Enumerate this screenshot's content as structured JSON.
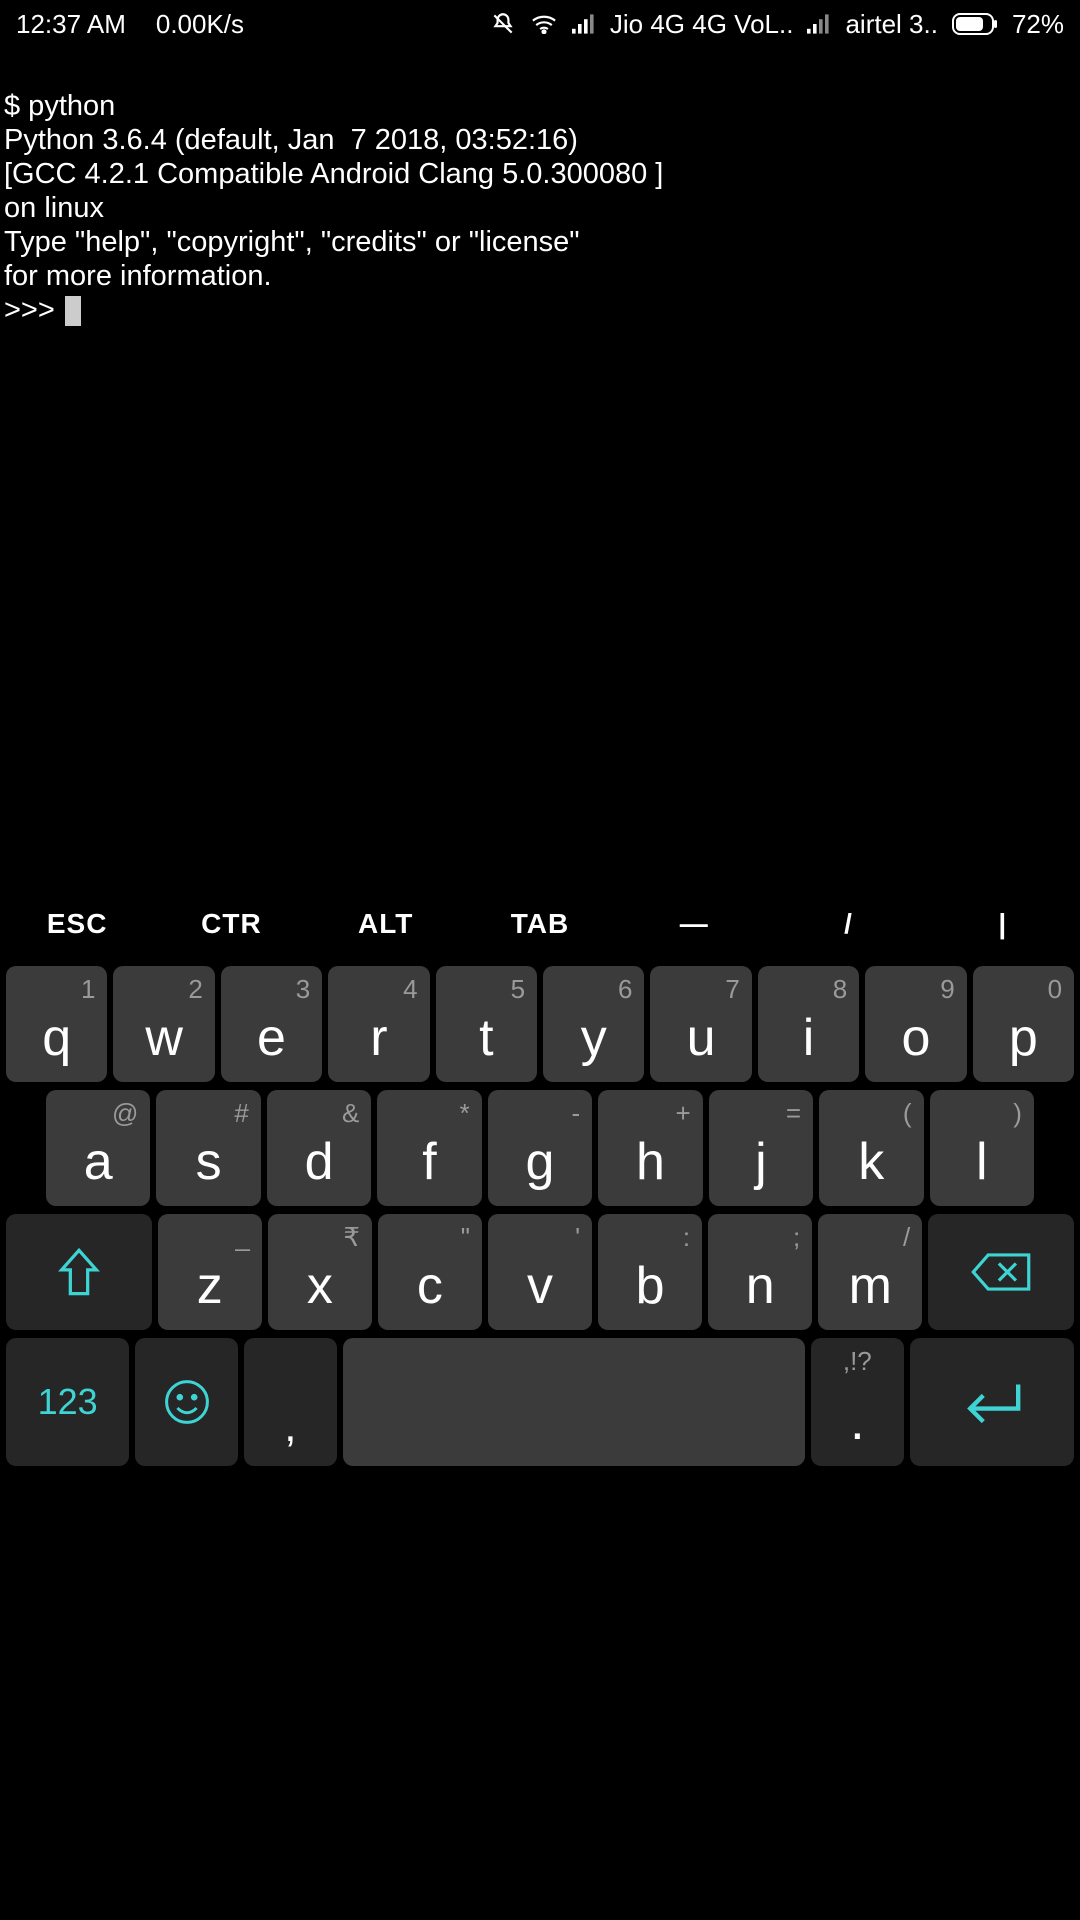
{
  "statusbar": {
    "time": "12:37 AM",
    "speed": "0.00K/s",
    "net1": "Jio 4G 4G VoL..",
    "net2": "airtel 3..",
    "battery": "72%"
  },
  "terminal": {
    "line1": "$ python",
    "line2": "Python 3.6.4 (default, Jan  7 2018, 03:52:16)",
    "line3": "[GCC 4.2.1 Compatible Android Clang 5.0.300080 ]",
    "line4": "on linux",
    "line5": "Type \"help\", \"copyright\", \"credits\" or \"license\"",
    "line6": "for more information.",
    "prompt": ">>> "
  },
  "extrakeys": {
    "esc": "ESC",
    "ctr": "CTR",
    "alt": "ALT",
    "tab": "TAB",
    "dash": "—",
    "slash": "/",
    "pipe": "|"
  },
  "keys": {
    "row1": [
      {
        "h": "1",
        "m": "q"
      },
      {
        "h": "2",
        "m": "w"
      },
      {
        "h": "3",
        "m": "e"
      },
      {
        "h": "4",
        "m": "r"
      },
      {
        "h": "5",
        "m": "t"
      },
      {
        "h": "6",
        "m": "y"
      },
      {
        "h": "7",
        "m": "u"
      },
      {
        "h": "8",
        "m": "i"
      },
      {
        "h": "9",
        "m": "o"
      },
      {
        "h": "0",
        "m": "p"
      }
    ],
    "row2": [
      {
        "h": "@",
        "m": "a"
      },
      {
        "h": "#",
        "m": "s"
      },
      {
        "h": "&",
        "m": "d"
      },
      {
        "h": "*",
        "m": "f"
      },
      {
        "h": "-",
        "m": "g"
      },
      {
        "h": "+",
        "m": "h"
      },
      {
        "h": "=",
        "m": "j"
      },
      {
        "h": "(",
        "m": "k"
      },
      {
        "h": ")",
        "m": "l"
      }
    ],
    "row3": [
      {
        "h": "_",
        "m": "z"
      },
      {
        "h": "₹",
        "m": "x"
      },
      {
        "h": "\"",
        "m": "c"
      },
      {
        "h": "'",
        "m": "v"
      },
      {
        "h": ":",
        "m": "b"
      },
      {
        "h": ";",
        "m": "n"
      },
      {
        "h": "/",
        "m": "m"
      }
    ],
    "numlabel": "123",
    "comma": ",",
    "periodhint": ",!?",
    "period": "."
  }
}
